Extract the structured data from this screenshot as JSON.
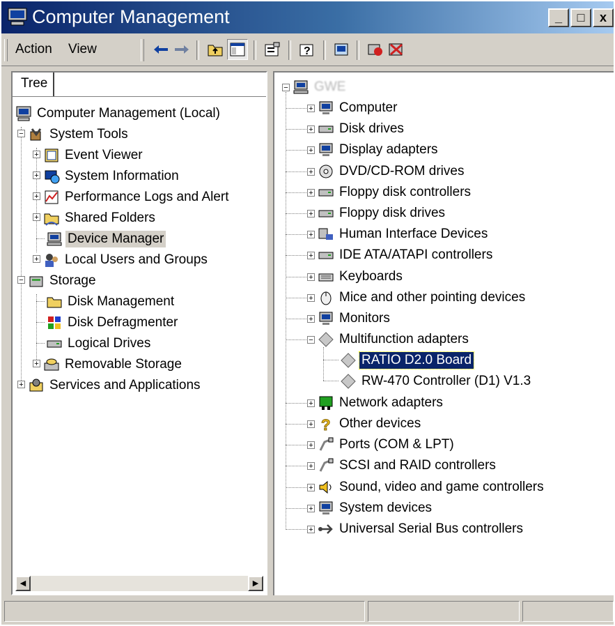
{
  "window": {
    "title": "Computer Management",
    "buttons": {
      "minimize": "_",
      "maximize": "□",
      "close": "x"
    }
  },
  "menu": {
    "action": "Action",
    "view": "View"
  },
  "left_tab": "Tree",
  "left_tree": {
    "root": "Computer Management (Local)",
    "system_tools": "System Tools",
    "event_viewer": "Event Viewer",
    "system_information": "System Information",
    "performance_logs": "Performance Logs and Alert",
    "shared_folders": "Shared Folders",
    "device_manager": "Device Manager",
    "local_users": "Local Users and Groups",
    "storage": "Storage",
    "disk_management": "Disk Management",
    "disk_defragmenter": "Disk Defragmenter",
    "logical_drives": "Logical Drives",
    "removable_storage": "Removable Storage",
    "services_apps": "Services and Applications"
  },
  "device_tree": {
    "computer_name": "GWE",
    "computer": "Computer",
    "disk_drives": "Disk drives",
    "display_adapters": "Display adapters",
    "dvd_cdrom": "DVD/CD-ROM drives",
    "floppy_controllers": "Floppy disk controllers",
    "floppy_drives": "Floppy disk drives",
    "hid": "Human Interface Devices",
    "ide": "IDE ATA/ATAPI controllers",
    "keyboards": "Keyboards",
    "mice": "Mice and other pointing devices",
    "monitors": "Monitors",
    "multifunction": "Multifunction adapters",
    "ratio_board": "RATIO D2.0 Board",
    "rw470": "RW-470 Controller (D1) V1.3",
    "network": "Network adapters",
    "other": "Other devices",
    "ports": "Ports (COM & LPT)",
    "scsi": "SCSI and RAID controllers",
    "sound": "Sound, video and game controllers",
    "system_devices": "System devices",
    "usb": "Universal Serial Bus controllers"
  },
  "colors": {
    "title_start": "#0a246a",
    "title_end": "#a6caf0",
    "selection": "#0a246a",
    "face": "#d4d0c8"
  }
}
